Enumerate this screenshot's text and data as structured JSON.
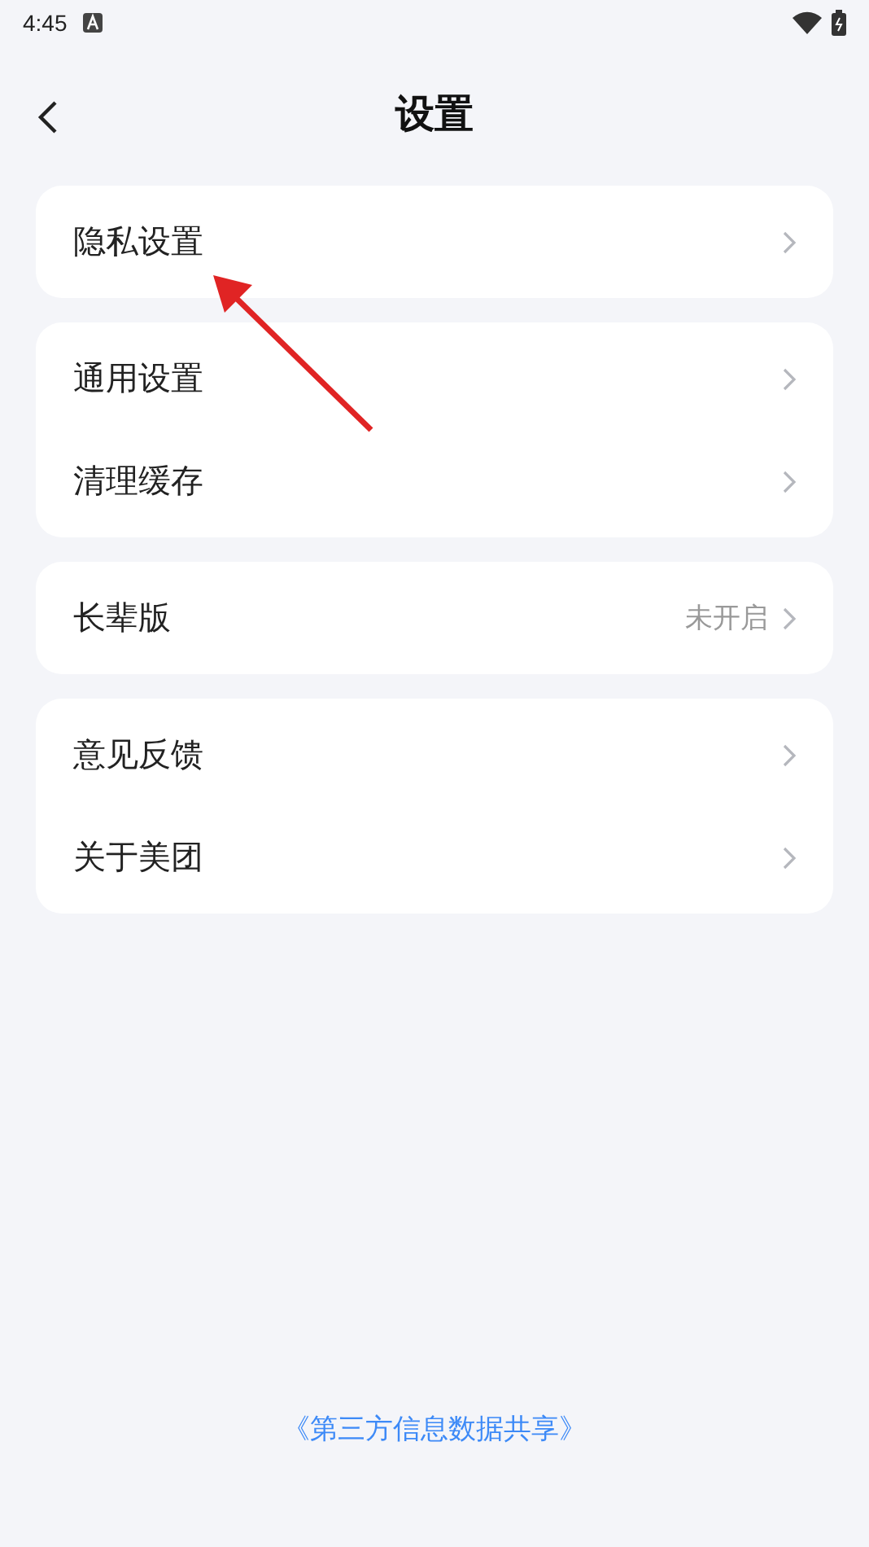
{
  "status_bar": {
    "time": "4:45"
  },
  "header": {
    "title": "设置"
  },
  "groups": [
    {
      "items": [
        {
          "label": "隐私设置"
        }
      ]
    },
    {
      "items": [
        {
          "label": "通用设置"
        },
        {
          "label": "清理缓存"
        }
      ]
    },
    {
      "items": [
        {
          "label": "长辈版",
          "value": "未开启"
        }
      ]
    },
    {
      "items": [
        {
          "label": "意见反馈"
        },
        {
          "label": "关于美团"
        }
      ]
    }
  ],
  "footer_link": "《第三方信息数据共享》"
}
